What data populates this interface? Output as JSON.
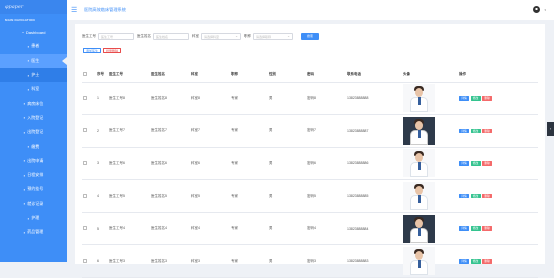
{
  "brand": {
    "logo_text": "φpaper",
    "section_title": "MAIN NAVIGATION"
  },
  "header": {
    "title": "医院高效临床管理系统"
  },
  "sidebar": {
    "items": [
      {
        "label": "Dashboard",
        "icon": "dashboard-icon"
      },
      {
        "label": "患者",
        "icon": "user-icon"
      },
      {
        "label": "医生",
        "icon": "doctor-icon"
      },
      {
        "label": "护士",
        "icon": "nurse-icon"
      },
      {
        "label": "科室",
        "icon": "department-icon"
      },
      {
        "label": "病房床位",
        "icon": "bed-icon"
      },
      {
        "label": "入院登记",
        "icon": "admission-icon"
      },
      {
        "label": "出院登记",
        "icon": "discharge-icon"
      },
      {
        "label": "缴费",
        "icon": "payment-icon"
      },
      {
        "label": "出院申请",
        "icon": "apply-icon"
      },
      {
        "label": "日程安排",
        "icon": "schedule-icon"
      },
      {
        "label": "预约挂号",
        "icon": "appointment-icon"
      },
      {
        "label": "就诊记录",
        "icon": "record-icon"
      },
      {
        "label": "护理",
        "icon": "care-icon"
      },
      {
        "label": "药品管理",
        "icon": "medicine-icon"
      }
    ]
  },
  "filter": {
    "doctor_no_label": "医生工号",
    "doctor_no_placeholder": "医生工号",
    "doctor_name_label": "医生姓名",
    "doctor_name_placeholder": "医生姓名",
    "dept_label": "科室",
    "dept_placeholder": "请选择科室",
    "title_label": "职称",
    "title_placeholder": "请选择职称",
    "search_label": "搜索"
  },
  "actions": {
    "add_label": "添加医生",
    "batch_delete_label": "批量删除"
  },
  "table": {
    "headers": [
      "",
      "序号",
      "医生工号",
      "医生姓名",
      "科室",
      "职称",
      "性别",
      "密码",
      "联系电话",
      "头像",
      "操作"
    ],
    "rows": [
      {
        "index": "1",
        "no": "医生工号8",
        "name": "医生姓名8",
        "dept": "科室8",
        "title": "专家",
        "gender": "男",
        "password": "密码8",
        "phone": "13823888888"
      },
      {
        "index": "2",
        "no": "医生工号7",
        "name": "医生姓名7",
        "dept": "科室7",
        "title": "专家",
        "gender": "男",
        "password": "密码7",
        "phone": "13823888887"
      },
      {
        "index": "3",
        "no": "医生工号6",
        "name": "医生姓名6",
        "dept": "科室6",
        "title": "专家",
        "gender": "男",
        "password": "密码6",
        "phone": "13823888886"
      },
      {
        "index": "4",
        "no": "医生工号5",
        "name": "医生姓名5",
        "dept": "科室5",
        "title": "专家",
        "gender": "男",
        "password": "密码5",
        "phone": "13823888885"
      },
      {
        "index": "5",
        "no": "医生工号4",
        "name": "医生姓名4",
        "dept": "科室4",
        "title": "专家",
        "gender": "男",
        "password": "密码4",
        "phone": "13823888884"
      },
      {
        "index": "6",
        "no": "医生工号3",
        "name": "医生姓名3",
        "dept": "科室3",
        "title": "专家",
        "gender": "男",
        "password": "密码3",
        "phone": "13823888883"
      }
    ],
    "op_view": "详情",
    "op_edit": "修改",
    "op_delete": "删除"
  }
}
